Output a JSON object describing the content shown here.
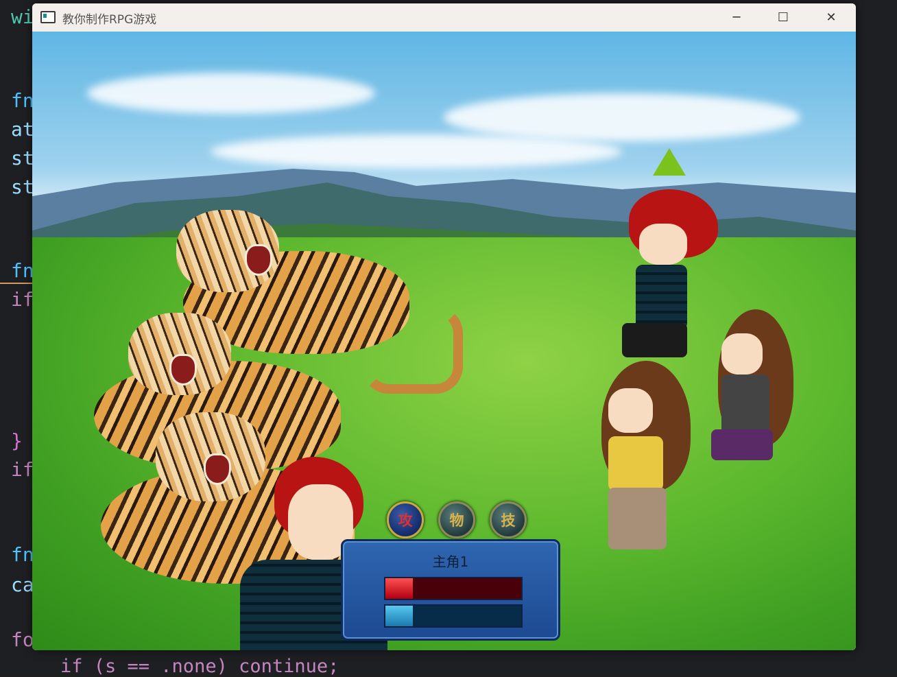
{
  "editor": {
    "lines": [
      {
        "text": "wi",
        "cls": "kw-wi"
      },
      {
        "text": "fn",
        "cls": "kw-fn"
      },
      {
        "text": "at",
        "cls": "kw-id"
      },
      {
        "text": "st",
        "cls": "kw-id"
      },
      {
        "text": "st",
        "cls": "kw-id"
      },
      {
        "text": "fn",
        "cls": "kw-fn"
      },
      {
        "text": "if",
        "cls": "kw-if"
      },
      {
        "text": "}",
        "cls": "kw-br"
      },
      {
        "text": "if",
        "cls": "kw-if"
      },
      {
        "text": "fn",
        "cls": "kw-fn"
      },
      {
        "text": "ca",
        "cls": "kw-id"
      },
      {
        "text": "fo",
        "cls": "kw-if"
      }
    ],
    "bottom_line": "if (s == .none) continue;"
  },
  "window": {
    "title": "教你制作RPG游戏",
    "minimize_glyph": "─",
    "maximize_glyph": "☐",
    "close_glyph": "✕"
  },
  "battle": {
    "commands": [
      {
        "label": "攻",
        "active": true
      },
      {
        "label": "物",
        "active": false
      },
      {
        "label": "技",
        "active": false
      }
    ],
    "status": {
      "name": "主角1",
      "hp_fraction": 0.2,
      "mp_fraction": 0.2
    },
    "enemies": [
      "tiger",
      "tiger",
      "tiger"
    ],
    "party": [
      "red-haired-hero",
      "brunette-girl",
      "ponytail-girl"
    ]
  },
  "colors": {
    "hp": "#c0101a",
    "mp": "#2a9ad0",
    "panel": "#2a5ea6",
    "selection_gem": "#7cc21c"
  }
}
